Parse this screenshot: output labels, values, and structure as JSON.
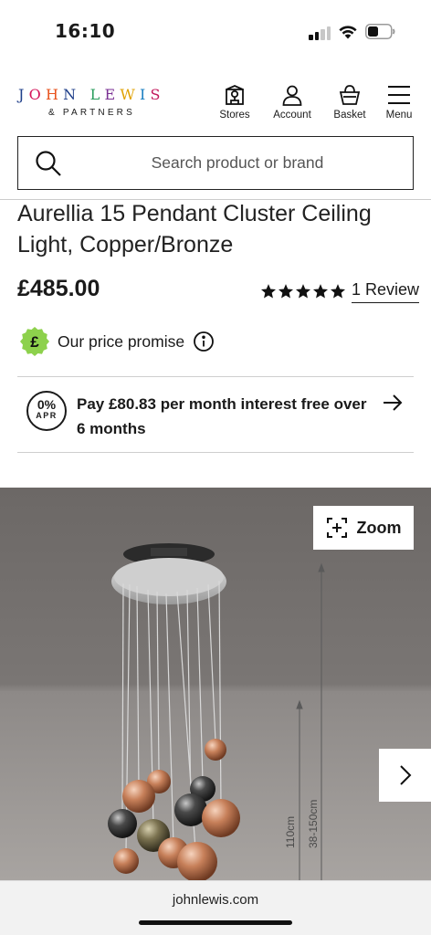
{
  "status_bar": {
    "time": "16:10"
  },
  "brand": {
    "line1": "JOHN LEWIS",
    "line2": "& PARTNERS"
  },
  "nav": {
    "stores": "Stores",
    "account": "Account",
    "basket": "Basket",
    "menu": "Menu"
  },
  "search": {
    "placeholder": "Search product or brand"
  },
  "product": {
    "title": "Aurellia 15 Pendant Cluster Ceiling Light, Copper/Bronze",
    "price": "£485.00",
    "rating": 5,
    "review_link": "1 Review"
  },
  "price_promise": {
    "badge": "£",
    "text": "Our price promise"
  },
  "finance": {
    "badge_pct": "0%",
    "badge_label": "APR",
    "text": "Pay £80.83 per month interest free over 6 months"
  },
  "gallery": {
    "zoom_label": "Zoom",
    "dimension_label_1": "110cm",
    "dimension_label_2": "38-150cm"
  },
  "browser": {
    "url": "johnlewis.com"
  },
  "colors": {
    "logo_letters": [
      "#1f3f8a",
      "#d4145a",
      "#e8531e",
      "#1f3f8a",
      "#2a9d5c",
      "#7b3294",
      "#e0a100",
      "#1a7fc1",
      "#c2185b"
    ],
    "price_promise_badge": "#8dd14c"
  }
}
